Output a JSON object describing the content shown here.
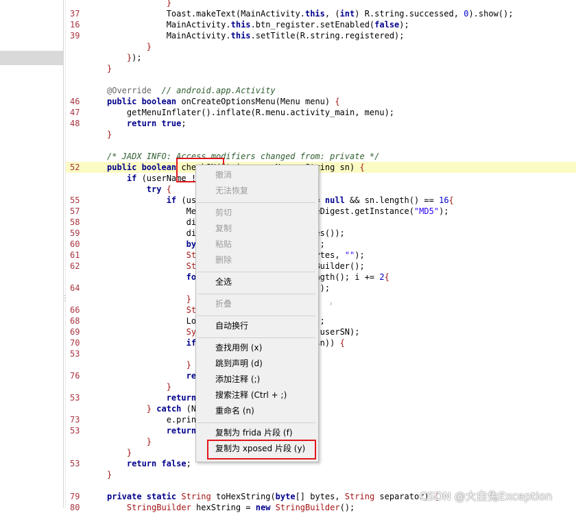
{
  "editor": {
    "lines": [
      {
        "gutter": "",
        "tokens": [
          [
            "br",
            "            }"
          ]
        ]
      },
      {
        "gutter": "37",
        "tokens": [
          [
            "",
            "            Toast.makeText(MainActivity."
          ],
          [
            "kw",
            "this"
          ],
          [
            "",
            ", ("
          ],
          [
            "kw",
            "int"
          ],
          [
            "",
            ") R.string.successed, "
          ],
          [
            "lit",
            "0"
          ],
          [
            "",
            ").show();"
          ]
        ]
      },
      {
        "gutter": "16",
        "tokens": [
          [
            "",
            "            MainActivity."
          ],
          [
            "kw",
            "this"
          ],
          [
            "",
            ".btn_register.setEnabled("
          ],
          [
            "kw",
            "false"
          ],
          [
            "",
            ");"
          ]
        ]
      },
      {
        "gutter": "39",
        "tokens": [
          [
            "",
            "            MainActivity."
          ],
          [
            "kw",
            "this"
          ],
          [
            "",
            ".setTitle(R.string.registered);"
          ]
        ]
      },
      {
        "gutter": "",
        "tokens": [
          [
            "br",
            "        }"
          ]
        ]
      },
      {
        "gutter": "",
        "tokens": [
          [
            "br",
            "    }"
          ],
          [
            "",
            ");"
          ]
        ]
      },
      {
        "gutter": "",
        "tokens": [
          [
            "br",
            "}"
          ]
        ]
      },
      {
        "gutter": "",
        "tokens": [
          [
            "",
            ""
          ]
        ]
      },
      {
        "gutter": "",
        "tokens": [
          [
            "an",
            "@Override"
          ],
          [
            "",
            "  "
          ],
          [
            "cm",
            "// android.app.Activity"
          ]
        ]
      },
      {
        "gutter": "46",
        "tokens": [
          [
            "kw",
            "public boolean"
          ],
          [
            "",
            " onCreateOptionsMenu(Menu menu) "
          ],
          [
            "br",
            "{"
          ]
        ]
      },
      {
        "gutter": "47",
        "tokens": [
          [
            "",
            "    getMenuInflater().inflate(R.menu.activity_main, menu);"
          ]
        ]
      },
      {
        "gutter": "48",
        "tokens": [
          [
            "kw",
            "    return true"
          ],
          [
            "",
            ";"
          ]
        ]
      },
      {
        "gutter": "",
        "tokens": [
          [
            "br",
            "}"
          ]
        ]
      },
      {
        "gutter": "",
        "tokens": [
          [
            "",
            ""
          ]
        ]
      },
      {
        "gutter": "",
        "tokens": [
          [
            "cm",
            "/* JADX INFO: Access modifiers changed from: private */"
          ]
        ]
      },
      {
        "gutter": "52",
        "hl": true,
        "tokens": [
          [
            "kw",
            "public boolean"
          ],
          [
            "",
            " checkSN(String userName, String sn) "
          ],
          [
            "br",
            "{"
          ]
        ]
      },
      {
        "gutter": "",
        "tokens": [
          [
            "kw",
            "    if"
          ],
          [
            "",
            " (userName != null"
          ]
        ]
      },
      {
        "gutter": "",
        "tokens": [
          [
            "kw",
            "        try"
          ],
          [
            "",
            " "
          ],
          [
            "br",
            "{"
          ]
        ]
      },
      {
        "gutter": "55",
        "tokens": [
          [
            "kw",
            "            if"
          ],
          [
            "",
            " (use                      != "
          ],
          [
            "kw",
            "null"
          ],
          [
            "",
            " && sn.length() == "
          ],
          [
            "lit",
            "16"
          ],
          [
            ") "
          ],
          [
            "br",
            "{"
          ]
        ]
      },
      {
        "gutter": "57",
        "tokens": [
          [
            "",
            "                Mes                      geDigest.getInstance("
          ],
          [
            "str",
            "\"MD5\""
          ],
          [
            "",
            ");"
          ]
        ]
      },
      {
        "gutter": "58",
        "tokens": [
          [
            "",
            "                dig"
          ]
        ]
      },
      {
        "gutter": "59",
        "tokens": [
          [
            "",
            "                dig                      tes());"
          ]
        ]
      },
      {
        "gutter": "60",
        "tokens": [
          [
            "kw",
            "                byt"
          ],
          [
            "",
            "                      ();"
          ]
        ]
      },
      {
        "gutter": "61",
        "tokens": [
          [
            "ty",
            "                Str"
          ],
          [
            "",
            "                      bytes, "
          ],
          [
            "str",
            "\"\""
          ],
          [
            "",
            ");"
          ]
        ]
      },
      {
        "gutter": "62",
        "tokens": [
          [
            "ty",
            "                Str"
          ],
          [
            "",
            "                      gBuilder();"
          ]
        ]
      },
      {
        "gutter": "",
        "tokens": [
          [
            "kw",
            "                for"
          ],
          [
            "",
            "                      ength(); i += "
          ],
          [
            "lit",
            "2"
          ],
          [
            ") "
          ],
          [
            "br",
            "{"
          ]
        ]
      },
      {
        "gutter": "64",
        "tokens": [
          [
            "",
            "                                         i));"
          ]
        ]
      },
      {
        "gutter": "",
        "tokens": [
          [
            "br",
            "                }"
          ]
        ]
      },
      {
        "gutter": "66",
        "tokens": [
          [
            "ty",
            "                Str"
          ],
          [
            "",
            "                      );"
          ]
        ]
      },
      {
        "gutter": "68",
        "tokens": [
          [
            "",
            "                Log                      N);"
          ]
        ]
      },
      {
        "gutter": "69",
        "tokens": [
          [
            "ty",
            "                Sys"
          ],
          [
            "",
            "                      + userSN);"
          ]
        ]
      },
      {
        "gutter": "70",
        "tokens": [
          [
            "kw",
            "                if"
          ],
          [
            "",
            "                       (sn)) "
          ],
          [
            "br",
            "{"
          ]
        ]
      },
      {
        "gutter": "53",
        "tokens": [
          [
            "",
            ""
          ]
        ]
      },
      {
        "gutter": "",
        "tokens": [
          [
            "br",
            "                }"
          ]
        ]
      },
      {
        "gutter": "76",
        "tokens": [
          [
            "kw",
            "                ret"
          ]
        ]
      },
      {
        "gutter": "",
        "tokens": [
          [
            "br",
            "            }"
          ]
        ]
      },
      {
        "gutter": "53",
        "tokens": [
          [
            "kw",
            "            return"
          ]
        ]
      },
      {
        "gutter": "",
        "tokens": [
          [
            "br",
            "        }"
          ],
          [
            "",
            " "
          ],
          [
            "kw",
            "catch"
          ],
          [
            "",
            " (No                      "
          ],
          [
            "br",
            "{"
          ]
        ]
      },
      {
        "gutter": "73",
        "tokens": [
          [
            "",
            "            e.print"
          ]
        ]
      },
      {
        "gutter": "53",
        "tokens": [
          [
            "kw",
            "            return"
          ]
        ]
      },
      {
        "gutter": "",
        "tokens": [
          [
            "br",
            "        }"
          ]
        ]
      },
      {
        "gutter": "",
        "tokens": [
          [
            "br",
            "    }"
          ]
        ]
      },
      {
        "gutter": "53",
        "tokens": [
          [
            "kw",
            "    return false"
          ],
          [
            "",
            ";"
          ]
        ]
      },
      {
        "gutter": "",
        "tokens": [
          [
            "br",
            "}"
          ]
        ]
      },
      {
        "gutter": "",
        "tokens": [
          [
            "",
            ""
          ]
        ]
      },
      {
        "gutter": "79",
        "tokens": [
          [
            "kw",
            "private static"
          ],
          [
            "",
            " "
          ],
          [
            "ty",
            "String"
          ],
          [
            "",
            " toHexString("
          ],
          [
            "kw",
            "byte"
          ],
          [
            "",
            "[] bytes, "
          ],
          [
            "ty",
            "String"
          ],
          [
            "",
            " separator) "
          ],
          [
            "br",
            "{"
          ]
        ]
      },
      {
        "gutter": "80",
        "tokens": [
          [
            "ty",
            "    StringBuilder"
          ],
          [
            "",
            " hexString = "
          ],
          [
            "kw",
            "new"
          ],
          [
            "",
            " "
          ],
          [
            "ty",
            "StringBuilder"
          ],
          [
            "",
            "();"
          ]
        ]
      }
    ]
  },
  "context_menu": {
    "items": [
      {
        "label": "撤消",
        "disabled": true
      },
      {
        "label": "无法恢复",
        "disabled": true
      },
      {
        "sep": true
      },
      {
        "label": "剪切",
        "disabled": true
      },
      {
        "label": "复制",
        "disabled": true
      },
      {
        "label": "粘贴",
        "disabled": true
      },
      {
        "label": "删除",
        "disabled": true
      },
      {
        "sep": true
      },
      {
        "label": "全选",
        "disabled": false
      },
      {
        "sep": true
      },
      {
        "label": "折叠",
        "disabled": true,
        "submenu": true
      },
      {
        "sep": true
      },
      {
        "label": "自动换行",
        "disabled": false
      },
      {
        "sep": true
      },
      {
        "label": "查找用例 (x)",
        "disabled": false
      },
      {
        "label": "跳到声明 (d)",
        "disabled": false
      },
      {
        "label": "添加注释 (;)",
        "disabled": false
      },
      {
        "label": "搜索注释 (Ctrl + ;)",
        "disabled": false
      },
      {
        "label": "重命名 (n)",
        "disabled": false
      },
      {
        "sep": true
      },
      {
        "label": "复制为 frida 片段 (f)",
        "disabled": false
      },
      {
        "label": "复制为 xposed 片段 (y)",
        "disabled": false
      }
    ]
  },
  "watermark": "CSDN @大白兔Exception",
  "colors": {
    "highlight": "#fbfbc4",
    "annotation_box": "#e0141a",
    "keyword": "#00008b",
    "gutter": "#a8323e"
  }
}
